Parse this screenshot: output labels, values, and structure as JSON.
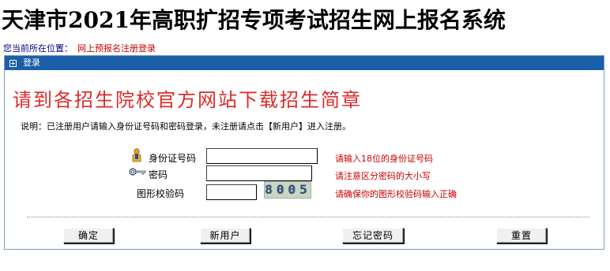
{
  "header": {
    "title": "天津市2021年高职扩招专项考试招生网上报名系统"
  },
  "breadcrumb": {
    "prefix": "您当前所在位置：",
    "current": "网上预报名注册登录"
  },
  "panel": {
    "title": "登录",
    "notice": "请到各招生院校官方网站下载招生简章",
    "explanation": "说明：已注册用户请输入身份证号码和密码登录，未注册请点击【新用户】进入注册。"
  },
  "form": {
    "id_label": "身份证号码",
    "id_value": "",
    "id_hint": "请输入18位的身份证号码",
    "password_label": "密码",
    "password_value": "",
    "password_hint": "请注意区分密码的大小写",
    "captcha_label": "图形校验码",
    "captcha_value": "",
    "captcha_image_text": "8005",
    "captcha_hint": "请确保你的图形校验码输入正确"
  },
  "buttons": {
    "confirm": "确定",
    "new_user": "新用户",
    "forgot_password": "忘记密码",
    "reset": "重置"
  },
  "colors": {
    "header_bar": "#1a5fa8",
    "notice_text": "#dd2a2a",
    "hint_text": "#cc0000",
    "breadcrumb_text": "#000080"
  }
}
